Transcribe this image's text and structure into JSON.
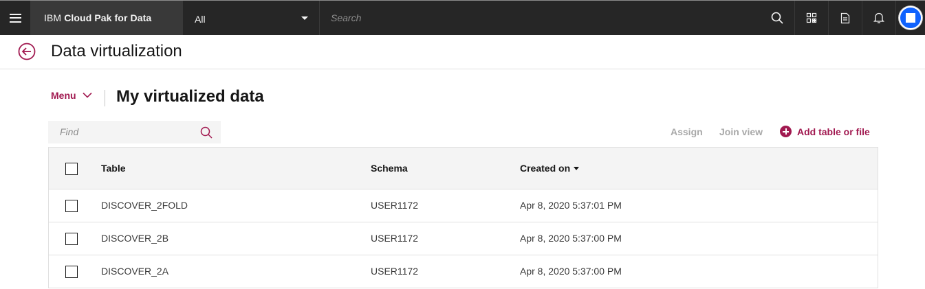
{
  "header": {
    "brand_prefix": "IBM",
    "brand_name": "Cloud Pak for Data",
    "scope_value": "All",
    "search_placeholder": "Search",
    "icons": [
      "menu-icon",
      "search-icon",
      "catalog-icon",
      "document-icon",
      "notification-icon",
      "avatar"
    ]
  },
  "page": {
    "title": "Data virtualization",
    "back_icon": "arrow-left-circle-icon"
  },
  "subheader": {
    "menu_label": "Menu",
    "section_title": "My virtualized data"
  },
  "toolbar": {
    "find_placeholder": "Find",
    "assign_label": "Assign",
    "join_view_label": "Join view",
    "add_label": "Add table or file"
  },
  "table": {
    "columns": [
      "Table",
      "Schema",
      "Created on"
    ],
    "sorted_column": "Created on",
    "sort_direction": "descending",
    "rows": [
      {
        "table": "DISCOVER_2FOLD",
        "schema": "USER1172",
        "created": "Apr 8, 2020 5:37:01 PM"
      },
      {
        "table": "DISCOVER_2B",
        "schema": "USER1172",
        "created": "Apr 8, 2020 5:37:00 PM"
      },
      {
        "table": "DISCOVER_2A",
        "schema": "USER1172",
        "created": "Apr 8, 2020 5:37:00 PM"
      }
    ]
  },
  "colors": {
    "accent": "#a11950",
    "header_bg": "#262626",
    "avatar": "#0f62fe"
  }
}
